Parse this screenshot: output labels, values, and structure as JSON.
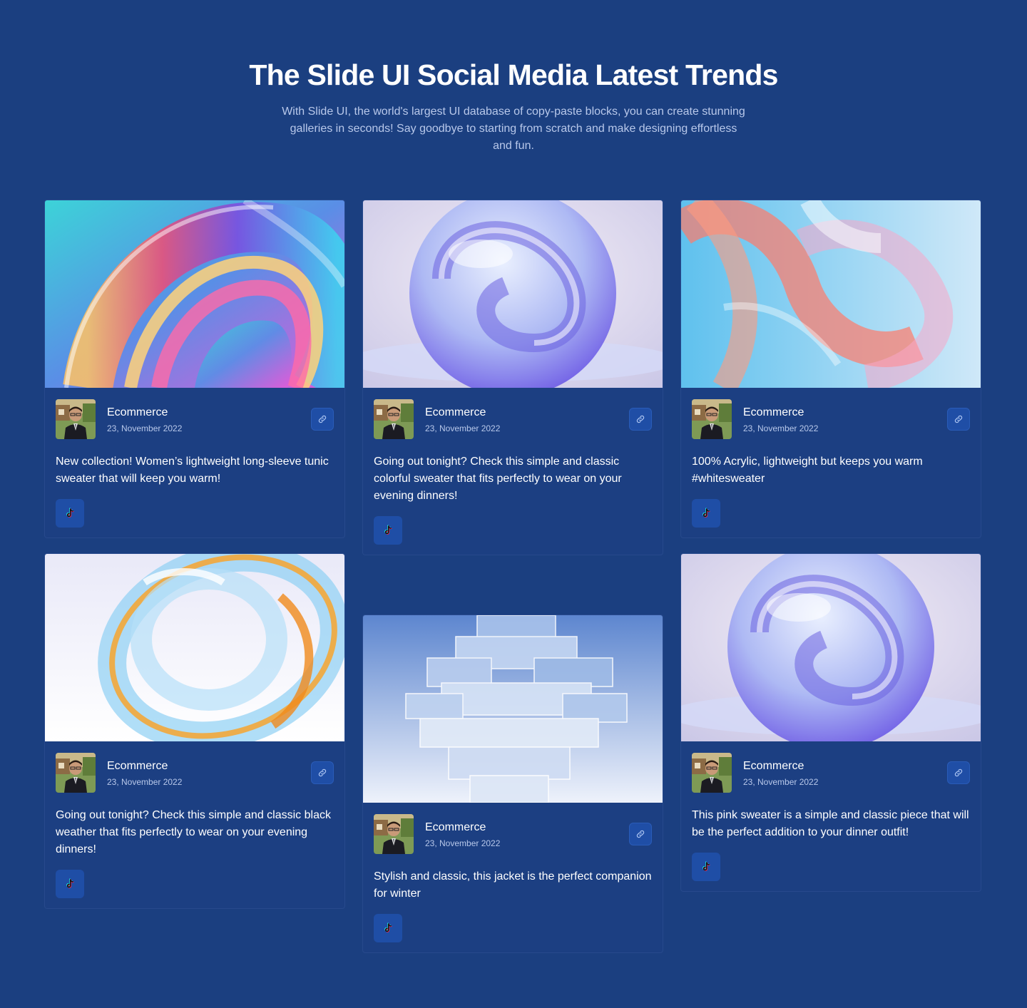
{
  "header": {
    "title": "The Slide UI Social Media Latest Trends",
    "subtitle": "With Slide UI, the world's largest UI database of copy-paste blocks, you can create stunning galleries in seconds! Say goodbye to starting from scratch and make designing effortless and fun."
  },
  "colors": {
    "background": "#1b3f80",
    "card": "#1c3f82",
    "button": "#1f4ea6",
    "muted_text": "#b8c8ea"
  },
  "cards": [
    {
      "image": "abstract-swirl-rainbow",
      "author": "Ecommerce",
      "date": "23, November 2022",
      "text": "New collection! Women’s lightweight long-sleeve tunic sweater that will keep you warm!",
      "link_icon": "link-icon",
      "social_icon": "tiktok-icon"
    },
    {
      "image": "glass-sphere-purple",
      "author": "Ecommerce",
      "date": "23, November 2022",
      "text": "Going out tonight? Check this simple and classic colorful sweater that fits perfectly to wear on your evening dinners!",
      "link_icon": "link-icon",
      "social_icon": "tiktok-icon"
    },
    {
      "image": "glass-ribbons-pink-blue",
      "author": "Ecommerce",
      "date": "23, November 2022",
      "text": "100% Acrylic, lightweight but keeps you warm #whitesweater",
      "link_icon": "link-icon",
      "social_icon": "tiktok-icon"
    },
    {
      "image": "glass-ring-gold",
      "author": "Ecommerce",
      "date": "23, November 2022",
      "text": "Going out tonight? Check this simple and classic black weather that fits perfectly to wear on your evening dinners!",
      "link_icon": "link-icon",
      "social_icon": "tiktok-icon"
    },
    {
      "image": "glass-cube-tower",
      "author": "Ecommerce",
      "date": "23, November 2022",
      "text": "Stylish and classic, this jacket is the perfect companion for winter",
      "link_icon": "link-icon",
      "social_icon": "tiktok-icon"
    },
    {
      "image": "glass-sphere-purple",
      "author": "Ecommerce",
      "date": "23, November 2022",
      "text": "This pink sweater is a simple and classic piece that will be the perfect addition to your dinner outfit!",
      "link_icon": "link-icon",
      "social_icon": "tiktok-icon"
    }
  ]
}
